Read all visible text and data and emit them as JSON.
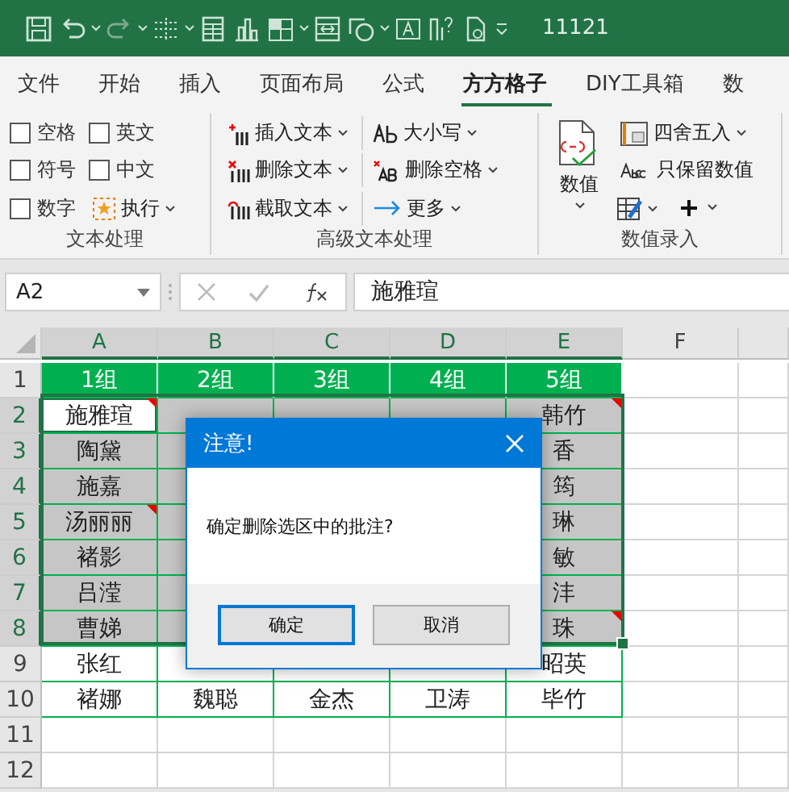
{
  "window": {
    "title": "11121"
  },
  "tabs": [
    {
      "label": "文件",
      "selected": false
    },
    {
      "label": "开始",
      "selected": false
    },
    {
      "label": "插入",
      "selected": false
    },
    {
      "label": "页面布局",
      "selected": false
    },
    {
      "label": "公式",
      "selected": false
    },
    {
      "label": "方方格子",
      "selected": true
    },
    {
      "label": "DIY工具箱",
      "selected": false
    },
    {
      "label": "数",
      "selected": false
    }
  ],
  "ribbon": {
    "groups": [
      {
        "label": "文本处理",
        "checkboxes": [
          {
            "label": "空格",
            "checked": false
          },
          {
            "label": "英文",
            "checked": false
          },
          {
            "label": "符号",
            "checked": false
          },
          {
            "label": "中文",
            "checked": false
          },
          {
            "label": "数字",
            "checked": false
          }
        ],
        "run_button": "执行"
      },
      {
        "label": "高级文本处理",
        "buttons": [
          "插入文本",
          "大小写",
          "删除文本",
          "删除空格",
          "截取文本",
          "更多"
        ]
      },
      {
        "label": "数值录入",
        "big_button": "数值",
        "buttons": [
          "四舍五入",
          "只保留数值"
        ]
      }
    ]
  },
  "formula_bar": {
    "name_box": "A2",
    "formula": "施雅瑄"
  },
  "sheet": {
    "columns": [
      "A",
      "B",
      "C",
      "D",
      "E",
      "F"
    ],
    "rows": [
      {
        "number": "1",
        "kind": "header",
        "cells": [
          {
            "text": "1组"
          },
          {
            "text": "2组"
          },
          {
            "text": "3组"
          },
          {
            "text": "4组"
          },
          {
            "text": "5组"
          }
        ]
      },
      {
        "number": "2",
        "kind": "data",
        "cells": [
          {
            "text": "施雅瑄",
            "selected": true,
            "active": true,
            "comment": true
          },
          {
            "selected": true,
            "active": false,
            "comment": false
          },
          {
            "selected": true,
            "active": false,
            "comment": false
          },
          {
            "selected": true,
            "active": false,
            "comment": false
          },
          {
            "text": "韩竹",
            "selected": true,
            "active": false,
            "comment": true
          }
        ]
      },
      {
        "number": "3",
        "kind": "data",
        "cells": [
          {
            "text": "陶黛",
            "selected": true,
            "active": false,
            "comment": false
          },
          null,
          null,
          null,
          {
            "text": "香",
            "selected": true,
            "active": false,
            "comment": false
          }
        ]
      },
      {
        "number": "4",
        "kind": "data",
        "cells": [
          {
            "text": "施嘉",
            "selected": true,
            "active": false,
            "comment": false
          },
          null,
          null,
          null,
          {
            "text": "筠",
            "selected": true,
            "active": false,
            "comment": false
          }
        ]
      },
      {
        "number": "5",
        "kind": "data",
        "cells": [
          {
            "text": "汤丽丽",
            "selected": true,
            "active": false,
            "comment": true
          },
          null,
          null,
          null,
          {
            "text": "琳",
            "selected": true,
            "active": false,
            "comment": false
          }
        ]
      },
      {
        "number": "6",
        "kind": "data",
        "cells": [
          {
            "text": "褚影",
            "selected": true,
            "active": false,
            "comment": false
          },
          null,
          null,
          null,
          {
            "text": "敏",
            "selected": true,
            "active": false,
            "comment": false
          }
        ]
      },
      {
        "number": "7",
        "kind": "data",
        "cells": [
          {
            "text": "吕滢",
            "selected": true,
            "active": false,
            "comment": false
          },
          null,
          null,
          null,
          {
            "text": "沣",
            "selected": true,
            "active": false,
            "comment": false
          }
        ]
      },
      {
        "number": "8",
        "kind": "data",
        "cells": [
          {
            "text": "曹娣",
            "selected": true,
            "active": false,
            "comment": false
          },
          null,
          null,
          null,
          {
            "text": "珠",
            "selected": true,
            "active": false,
            "comment": true
          }
        ]
      },
      {
        "number": "9",
        "kind": "data",
        "cells": [
          {
            "text": "张红",
            "selected": false,
            "active": false,
            "comment": false
          },
          {
            "selected": false,
            "active": false
          },
          {
            "selected": false,
            "active": false
          },
          {
            "selected": false,
            "active": false
          },
          {
            "text": "昭英",
            "selected": false,
            "active": false,
            "comment": false
          }
        ]
      },
      {
        "number": "10",
        "kind": "data",
        "cells": [
          {
            "text": "褚娜",
            "selected": false,
            "active": false,
            "comment": false
          },
          {
            "text": "魏聪",
            "selected": false,
            "active": false,
            "comment": false
          },
          {
            "text": "金杰",
            "selected": false,
            "active": false,
            "comment": false
          },
          {
            "text": "卫涛",
            "selected": false,
            "active": false,
            "comment": false
          },
          {
            "text": "毕竹",
            "selected": false,
            "active": false,
            "comment": false
          }
        ]
      },
      {
        "number": "11",
        "kind": "empty"
      },
      {
        "number": "12",
        "kind": "empty"
      }
    ]
  },
  "dialog": {
    "title": "注意!",
    "message": "确定删除选区中的批注?",
    "buttons": [
      {
        "label": "确定",
        "selected": true
      },
      {
        "label": "取消",
        "selected": false
      }
    ]
  }
}
